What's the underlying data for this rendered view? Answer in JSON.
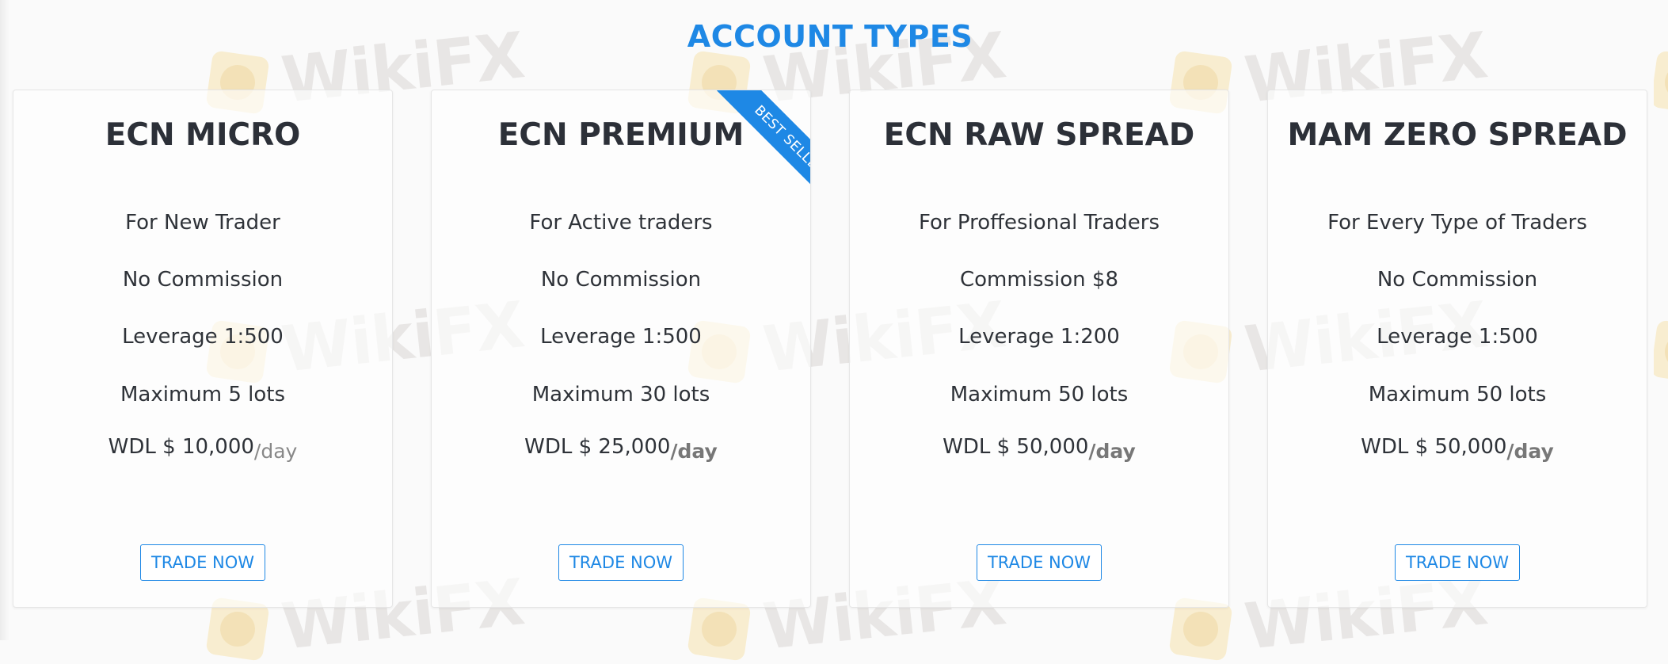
{
  "header": {
    "title": "ACCOUNT TYPES"
  },
  "watermark": {
    "text": "WikiFX"
  },
  "colors": {
    "accent": "#1e88e5",
    "text": "#2c3038",
    "muted": "#888888"
  },
  "plans": [
    {
      "name": "ECN MICRO",
      "audience": "For New Trader",
      "commission": "No Commission",
      "leverage": "Leverage 1:500",
      "max_lots": "Maximum 5 lots",
      "withdrawal": "WDL $ 10,000",
      "per_day": "/day",
      "cta": "TRADE NOW"
    },
    {
      "name": "ECN PREMIUM",
      "badge": "BEST SELLER",
      "audience": "For Active traders",
      "commission": "No Commission",
      "leverage": "Leverage 1:500",
      "max_lots": "Maximum 30 lots",
      "withdrawal": "WDL $ 25,000",
      "per_day": "/day",
      "cta": "TRADE NOW"
    },
    {
      "name": "ECN RAW SPREAD",
      "audience": "For Proffesional Traders",
      "commission": "Commission $8",
      "leverage": "Leverage 1:200",
      "max_lots": "Maximum 50 lots",
      "withdrawal": "WDL $ 50,000",
      "per_day": "/day",
      "cta": "TRADE NOW"
    },
    {
      "name": "MAM ZERO SPREAD",
      "audience": "For Every Type of Traders",
      "commission": "No Commission",
      "leverage": "Leverage 1:500",
      "max_lots": "Maximum 50 lots",
      "withdrawal": "WDL $ 50,000",
      "per_day": "/day",
      "cta": "TRADE NOW"
    }
  ]
}
